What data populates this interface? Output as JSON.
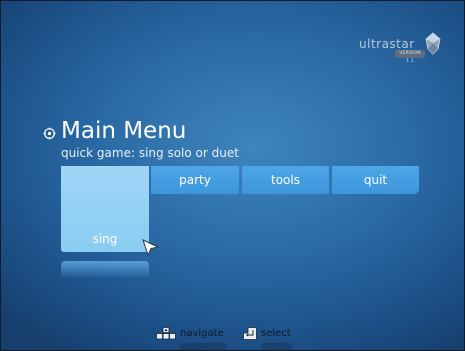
{
  "logo": {
    "word": "ultrastar",
    "badge": "VERSION 1.1",
    "color": "#b9c9da"
  },
  "menu": {
    "title": "Main Menu",
    "subtitle": "quick game: sing solo or duet",
    "title_icon": "gear-icon",
    "selected": "sing",
    "buttons": [
      {
        "id": "sing",
        "label": "sing",
        "selected": true,
        "color": "#8acdf2"
      },
      {
        "id": "party",
        "label": "party",
        "selected": false,
        "color": "#4da6e6"
      },
      {
        "id": "tools",
        "label": "tools",
        "selected": false,
        "color": "#4da6e6"
      },
      {
        "id": "quit",
        "label": "quit",
        "selected": false,
        "color": "#4da6e6"
      }
    ]
  },
  "footer": {
    "hints": [
      {
        "icon": "keyboard-arrows-icon",
        "label": "navigate"
      },
      {
        "icon": "enter-key-icon",
        "label": "select"
      }
    ]
  },
  "colors": {
    "background": "#2a6aa5",
    "selected_button": "#8acdf2",
    "button": "#4da6e6"
  }
}
